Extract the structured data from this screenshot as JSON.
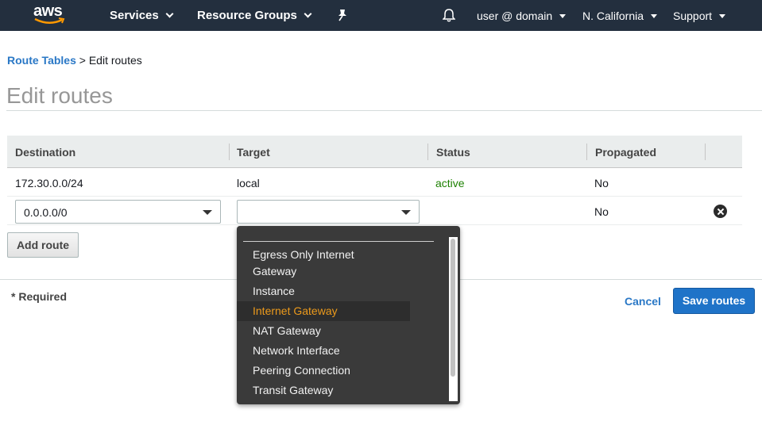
{
  "topbar": {
    "logo_text": "aws",
    "services": "Services",
    "resource_groups": "Resource Groups",
    "user": "user @ domain",
    "region": "N. California",
    "support": "Support"
  },
  "breadcrumb": {
    "parent": "Route Tables",
    "separator": ">",
    "current": "Edit routes"
  },
  "page": {
    "title": "Edit routes"
  },
  "table": {
    "headers": [
      "Destination",
      "Target",
      "Status",
      "Propagated"
    ],
    "rows": [
      {
        "destination": "172.30.0.0/24",
        "target": "local",
        "status": "active",
        "propagated": "No"
      },
      {
        "destination": "0.0.0.0/0",
        "target": "",
        "status": "",
        "propagated": "No"
      }
    ]
  },
  "buttons": {
    "add_route": "Add route",
    "cancel": "Cancel",
    "save": "Save routes"
  },
  "footer": {
    "required": "* Required"
  },
  "dropdown": {
    "items": [
      "Egress Only Internet Gateway",
      "Instance",
      "Internet Gateway",
      "NAT Gateway",
      "Network Interface",
      "Peering Connection",
      "Transit Gateway"
    ],
    "highlighted": "Internet Gateway"
  },
  "colors": {
    "topbar": "#232f3e",
    "link": "#2a78c6",
    "active": "#1d8102",
    "primary": "#1f73c8",
    "highlight": "#ec9a1c"
  }
}
